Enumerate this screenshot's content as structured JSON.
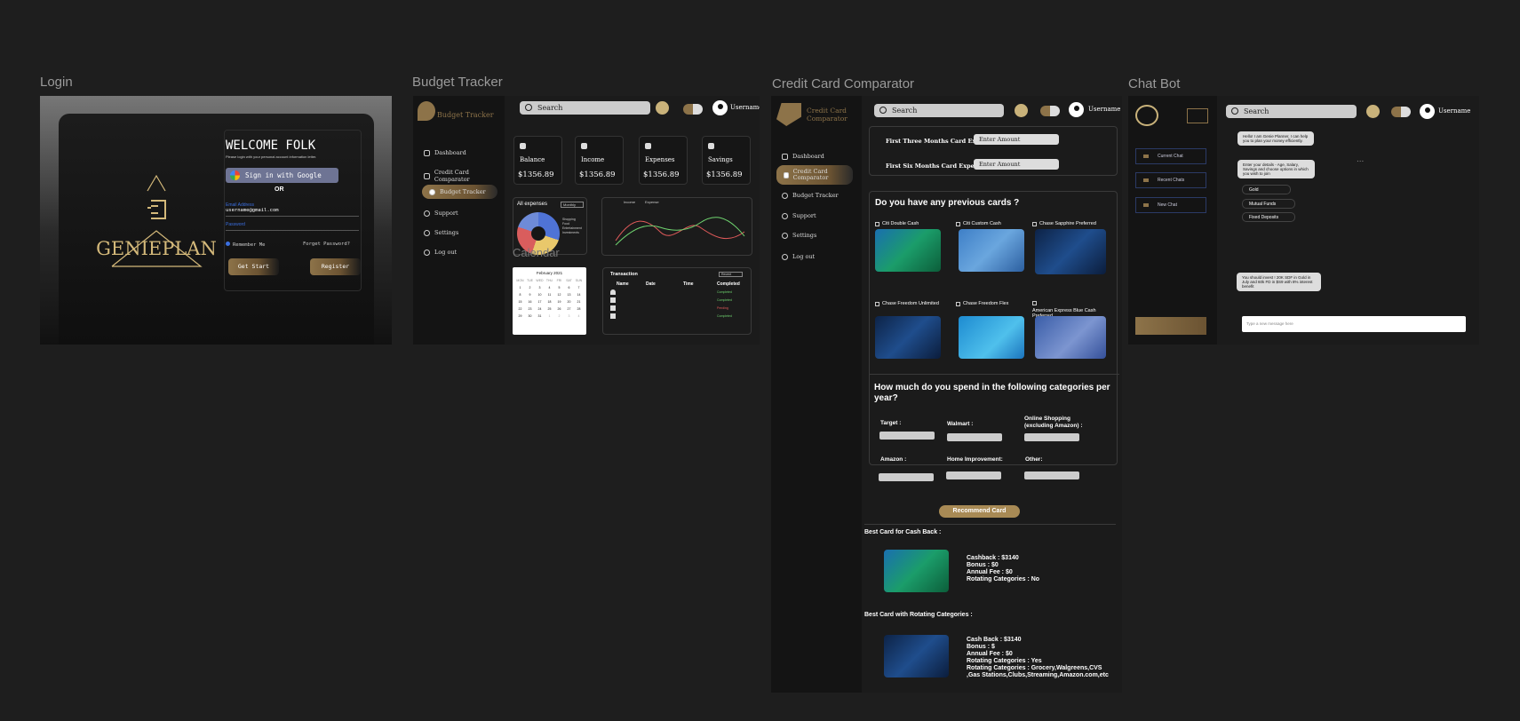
{
  "frames": {
    "login": "Login",
    "budget": "Budget Tracker",
    "cc": "Credit Card Comparator",
    "chat": "Chat Bot"
  },
  "login": {
    "brand": "GENIEPLAN",
    "welcome": "WELCOME FOLK",
    "subtitle": "Please login with your personal account information letter.",
    "google": "Sign in with Google",
    "or": "OR",
    "email_label": "Email Address",
    "email_value": "username@gmail.com",
    "password_label": "Password",
    "remember": "Remember Me",
    "forgot": "Forget Password?",
    "get_start": "Get Start",
    "register": "Register"
  },
  "budget": {
    "brand": "Budget Tracker",
    "nav": [
      "Dashboard",
      "Credit Card Comparator",
      "Budget Tracker",
      "Support",
      "Settings",
      "Log out"
    ],
    "search": "Search",
    "username": "Username",
    "stats": [
      {
        "title": "Balance",
        "value": "$1356.89"
      },
      {
        "title": "Income",
        "value": "$1356.89"
      },
      {
        "title": "Expenses",
        "value": "$1356.89"
      },
      {
        "title": "Savings",
        "value": "$1356.89"
      }
    ],
    "all_expenses": "All expenses",
    "monthly": "Monthly",
    "legend": [
      "Shopping",
      "Food",
      "Entertainment",
      "Investments"
    ],
    "chart_legend": [
      "Income",
      "Expense"
    ],
    "calendar_title": "Calendar",
    "month": "February 2021",
    "weekdays": [
      "MON",
      "TUE",
      "WED",
      "THU",
      "FRI",
      "SAT",
      "SUN"
    ],
    "days": [
      "1",
      "2",
      "3",
      "4",
      "5",
      "6",
      "7",
      "8",
      "9",
      "10",
      "11",
      "12",
      "13",
      "14",
      "15",
      "16",
      "17",
      "18",
      "19",
      "20",
      "21",
      "22",
      "23",
      "24",
      "25",
      "26",
      "27",
      "28",
      "29",
      "30",
      "31",
      "1",
      "2",
      "3",
      "4"
    ],
    "transaction": "Transaction",
    "tx_filter": "Recent",
    "tx_headers": [
      "Name",
      "Date",
      "Time",
      "Completed"
    ],
    "tx_status": [
      "Completed",
      "Completed",
      "Pending",
      "Completed"
    ],
    "colors": {
      "accent": "#8d7349",
      "income": "#6fd36f",
      "expense": "#e05a5a"
    }
  },
  "cc": {
    "brand": "Credit Card Comparator",
    "nav": [
      "Dashboard",
      "Credit Card Comparator",
      "Budget Tracker",
      "Support",
      "Settings",
      "Log out"
    ],
    "search": "Search",
    "username": "Username",
    "first_three": "First Three Months Card Expenditures:",
    "first_six": "First Six Months Card Expenditures:",
    "enter_amount": "Enter Amount",
    "prev_q": "Do you have any previous cards ?",
    "cards": [
      "Citi Double Cash",
      "Citi Custom Cash",
      "Chase Sapphire Preferred",
      "Chase Freedom Unlimited",
      "Chase Freedom Flex",
      "American Express Blue Cash Preferred"
    ],
    "spend_q": "How much do you spend in the following categories per year?",
    "categories": [
      "Target :",
      "Walmart :",
      "Online Shopping (excluding Amazon) :",
      "Amazon :",
      "Home Improvement:",
      "Other:"
    ],
    "recommend": "Recommend Card",
    "best_cashback": "Best Card for Cash Back :",
    "cashback_details": [
      "Cashback : $3140",
      "Bonus : $0",
      "Annual Fee : $0",
      "Rotating Categories : No"
    ],
    "best_rotating": "Best Card with Rotating Categories :",
    "rotating_details": [
      "Cash Back : $3140",
      "Bonus : $",
      "Annual Fee : $0",
      "Rotating Categories : Yes",
      "Rotating Categories : Grocery,Walgreens,CVS",
      ",Gas Stations,Clubs,Streaming,Amazon.com,etc"
    ]
  },
  "chat": {
    "search": "Search",
    "username": "Username",
    "nav": [
      "Current Chat",
      "Recent Chats",
      "New Chat"
    ],
    "bubble1": "Hello! I am Genie Planner, I can help you to plan your money efficiently.",
    "bubble2": "Enter your details - Age, Salary, Savings and choose options in which you wish to join",
    "options": [
      "Gold",
      "Mutual Funds",
      "Fixed Deposits"
    ],
    "bubble3": "You should invest ! 20K SDF in Gold in July and 60k FD in $S9 with 8% interest benefit",
    "placeholder": "Type a new message here",
    "more": "..."
  }
}
